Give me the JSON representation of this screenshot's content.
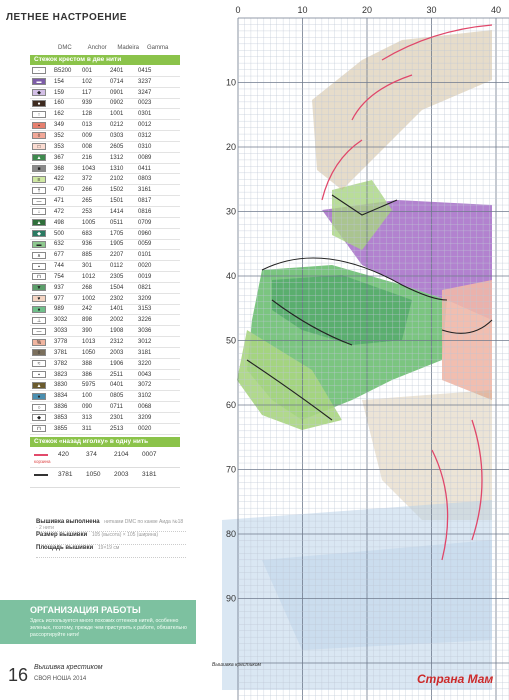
{
  "page": {
    "title": "ЛЕТНЕЕ НАСТРОЕНИЕ",
    "page_number": "16",
    "magazine": "Вышивка крестиком",
    "issue": "СВОЯ НОША 2014",
    "watermark": "Страна Мам",
    "small_logo": "Вышивка крестиком"
  },
  "key": {
    "headers": [
      "DMC",
      "Anchor",
      "Madeira",
      "Gamma"
    ],
    "cross_stitch_label": "Стежок крестом в две нити",
    "rows": [
      {
        "sym": "·",
        "color": "#ffffff",
        "dmc": "B5200",
        "anchor": "001",
        "madeira": "2401",
        "gamma": "0415"
      },
      {
        "sym": "▬",
        "color": "#7d5ca8",
        "dmc": "154",
        "anchor": "102",
        "madeira": "0714",
        "gamma": "3237"
      },
      {
        "sym": "◆",
        "color": "#d3bfe6",
        "dmc": "159",
        "anchor": "117",
        "madeira": "0901",
        "gamma": "3247"
      },
      {
        "sym": "●",
        "color": "#3d2a1f",
        "dmc": "160",
        "anchor": "939",
        "madeira": "0902",
        "gamma": "0023"
      },
      {
        "sym": "↑",
        "color": "#ffffff",
        "dmc": "162",
        "anchor": "128",
        "madeira": "1001",
        "gamma": "0301"
      },
      {
        "sym": "▪",
        "color": "#e6806f",
        "dmc": "349",
        "anchor": "013",
        "madeira": "0212",
        "gamma": "0012"
      },
      {
        "sym": "◊",
        "color": "#f2a898",
        "dmc": "352",
        "anchor": "009",
        "madeira": "0303",
        "gamma": "0312"
      },
      {
        "sym": "□",
        "color": "#fbdcd2",
        "dmc": "353",
        "anchor": "008",
        "madeira": "2605",
        "gamma": "0310"
      },
      {
        "sym": "▲",
        "color": "#3e8a4e",
        "dmc": "367",
        "anchor": "216",
        "madeira": "1312",
        "gamma": "0089"
      },
      {
        "sym": "■",
        "color": "#8a8a8a",
        "dmc": "368",
        "anchor": "1043",
        "madeira": "1310",
        "gamma": "0411"
      },
      {
        "sym": "≡",
        "color": "#cfe8a3",
        "dmc": "422",
        "anchor": "372",
        "madeira": "2102",
        "gamma": "0803"
      },
      {
        "sym": "†",
        "color": "#ffffff",
        "dmc": "470",
        "anchor": "266",
        "madeira": "1502",
        "gamma": "3161"
      },
      {
        "sym": "—",
        "color": "#ffffff",
        "dmc": "471",
        "anchor": "265",
        "madeira": "1501",
        "gamma": "0817"
      },
      {
        "sym": "↓",
        "color": "#ffffff",
        "dmc": "472",
        "anchor": "253",
        "madeira": "1414",
        "gamma": "0816"
      },
      {
        "sym": "▲",
        "color": "#2f6e3a",
        "dmc": "498",
        "anchor": "1005",
        "madeira": "0511",
        "gamma": "0709"
      },
      {
        "sym": "◆",
        "color": "#2a7a62",
        "dmc": "500",
        "anchor": "683",
        "madeira": "1705",
        "gamma": "0960"
      },
      {
        "sym": "▬",
        "color": "#8ec98f",
        "dmc": "632",
        "anchor": "936",
        "madeira": "1905",
        "gamma": "0059"
      },
      {
        "sym": "∧",
        "color": "#ffffff",
        "dmc": "677",
        "anchor": "885",
        "madeira": "2207",
        "gamma": "0101"
      },
      {
        "sym": "▪",
        "color": "#ffffff",
        "dmc": "744",
        "anchor": "301",
        "madeira": "0112",
        "gamma": "0020"
      },
      {
        "sym": "⊓",
        "color": "#ffffff",
        "dmc": "754",
        "anchor": "1012",
        "madeira": "2305",
        "gamma": "0019"
      },
      {
        "sym": "▼",
        "color": "#5b9e6a",
        "dmc": "937",
        "anchor": "268",
        "madeira": "1504",
        "gamma": "0821"
      },
      {
        "sym": "♥",
        "color": "#f5d5c3",
        "dmc": "977",
        "anchor": "1002",
        "madeira": "2302",
        "gamma": "3209"
      },
      {
        "sym": "●",
        "color": "#6fbf8a",
        "dmc": "989",
        "anchor": "242",
        "madeira": "1401",
        "gamma": "3153"
      },
      {
        "sym": "⊥",
        "color": "#ffffff",
        "dmc": "3032",
        "anchor": "898",
        "madeira": "2002",
        "gamma": "3226"
      },
      {
        "sym": "—",
        "color": "#ffffff",
        "dmc": "3033",
        "anchor": "390",
        "madeira": "1908",
        "gamma": "3036"
      },
      {
        "sym": "%",
        "color": "#f0b5a0",
        "dmc": "3778",
        "anchor": "1013",
        "madeira": "2312",
        "gamma": "3012"
      },
      {
        "sym": "◊",
        "color": "#7a6f5c",
        "dmc": "3781",
        "anchor": "1050",
        "madeira": "2003",
        "gamma": "3181"
      },
      {
        "sym": "≈",
        "color": "#ffffff",
        "dmc": "3782",
        "anchor": "388",
        "madeira": "1906",
        "gamma": "3220"
      },
      {
        "sym": "▪",
        "color": "#ffffff",
        "dmc": "3823",
        "anchor": "386",
        "madeira": "2511",
        "gamma": "0043"
      },
      {
        "sym": "▲",
        "color": "#6b5b2e",
        "dmc": "3830",
        "anchor": "5975",
        "madeira": "0401",
        "gamma": "3072"
      },
      {
        "sym": "●",
        "color": "#4a8fb0",
        "dmc": "3834",
        "anchor": "100",
        "madeira": "0805",
        "gamma": "3102"
      },
      {
        "sym": "○",
        "color": "#ffffff",
        "dmc": "3836",
        "anchor": "090",
        "madeira": "0711",
        "gamma": "0068"
      },
      {
        "sym": "◆",
        "color": "#ffffff",
        "dmc": "3853",
        "anchor": "313",
        "madeira": "2301",
        "gamma": "3209"
      },
      {
        "sym": "⊓",
        "color": "#ffffff",
        "dmc": "3855",
        "anchor": "311",
        "madeira": "2513",
        "gamma": "0020"
      }
    ],
    "backstitch_label": "Стежок «назад иголку» в одну нить",
    "backstitch_rows": [
      {
        "color": "#e24a6b",
        "caption": "корзина",
        "dmc": "420",
        "anchor": "374",
        "madeira": "2104",
        "gamma": "0007"
      },
      {
        "color": "#333333",
        "caption": "",
        "dmc": "3781",
        "anchor": "1050",
        "madeira": "2003",
        "gamma": "3181"
      }
    ]
  },
  "info": {
    "made_label": "Вышивка выполнена",
    "made_value": "нитками DMC по канве Аида №18 · 2 нити",
    "size_label": "Размер вышивки",
    "size_value": "105 (высота) × 105 (ширина)",
    "area_label": "Площадь вышивки",
    "area_value": "19×19 см"
  },
  "org": {
    "title": "ОРГАНИЗАЦИЯ РАБОТЫ",
    "text": "Здесь используется много похожих оттенков нитей, особенно зеленых, поэтому, прежде чем приступить к работе, обязательно рассортируйте нити!"
  },
  "chart": {
    "col_labels": [
      "0",
      "10",
      "20",
      "30",
      "40"
    ],
    "row_labels": [
      "10",
      "20",
      "30",
      "40",
      "50",
      "60",
      "70",
      "80",
      "90"
    ],
    "colors": {
      "grid": "#bfc7d6",
      "grid_major": "#6f7a8c",
      "purple": "#a56cc7",
      "green_dark": "#3f9a5e",
      "green_mid": "#6dbf72",
      "green_light": "#a8d57f",
      "tan": "#c8b18a",
      "pink": "#f0b7a7",
      "pink_line": "#e0476a",
      "blue": "#bcd3ea",
      "outline": "#222222"
    }
  }
}
